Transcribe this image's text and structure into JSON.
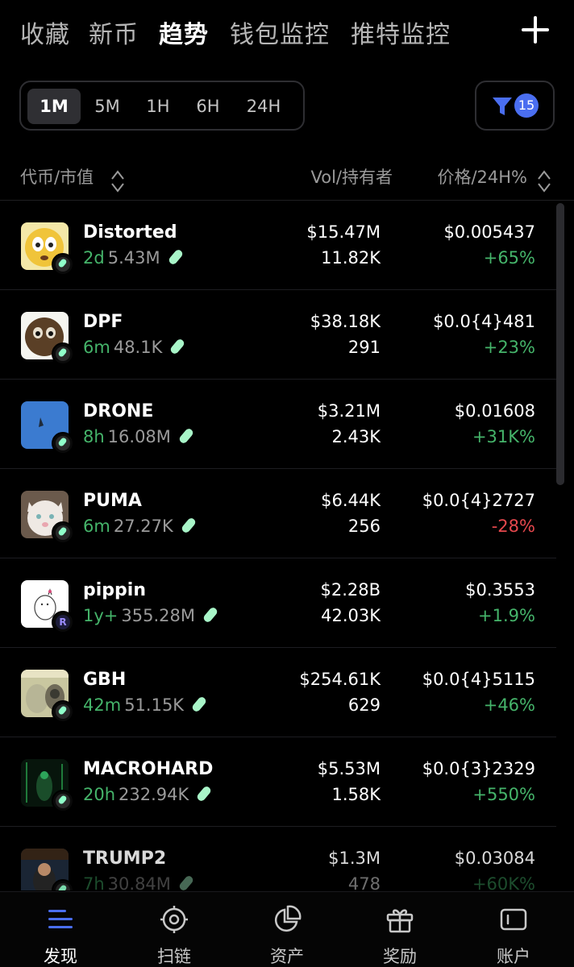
{
  "top_tabs": [
    {
      "label": "收藏"
    },
    {
      "label": "新币"
    },
    {
      "label": "趋势",
      "active": true
    },
    {
      "label": "钱包监控"
    },
    {
      "label": "推特监控"
    }
  ],
  "time_filters": [
    {
      "label": "1M",
      "active": true
    },
    {
      "label": "5M"
    },
    {
      "label": "1H"
    },
    {
      "label": "6H"
    },
    {
      "label": "24H"
    }
  ],
  "filter_count": "15",
  "columns": {
    "token": "代币/市值",
    "vol": "Vol/持有者",
    "price": "价格/24H%"
  },
  "rows": [
    {
      "name": "Distorted",
      "age": "2d",
      "mcap": "5.43M",
      "vol": "$15.47M",
      "holders": "11.82K",
      "price": "$0.005437",
      "change": "+65%",
      "trend": "up",
      "chip": "swap"
    },
    {
      "name": "DPF",
      "age": "6m",
      "mcap": "48.1K",
      "vol": "$38.18K",
      "holders": "291",
      "price": "$0.0{4}481",
      "change": "+23%",
      "trend": "up",
      "chip": "swap"
    },
    {
      "name": "DRONE",
      "age": "8h",
      "mcap": "16.08M",
      "vol": "$3.21M",
      "holders": "2.43K",
      "price": "$0.01608",
      "change": "+31K%",
      "trend": "up",
      "chip": "swap"
    },
    {
      "name": "PUMA",
      "age": "6m",
      "mcap": "27.27K",
      "vol": "$6.44K",
      "holders": "256",
      "price": "$0.0{4}2727",
      "change": "-28%",
      "trend": "down",
      "chip": "swap"
    },
    {
      "name": "pippin",
      "age": "1y+",
      "mcap": "355.28M",
      "vol": "$2.28B",
      "holders": "42.03K",
      "price": "$0.3553",
      "change": "+1.9%",
      "trend": "up",
      "chip": "raydium"
    },
    {
      "name": "GBH",
      "age": "42m",
      "mcap": "51.15K",
      "vol": "$254.61K",
      "holders": "629",
      "price": "$0.0{4}5115",
      "change": "+46%",
      "trend": "up",
      "chip": "swap"
    },
    {
      "name": "MACROHARD",
      "age": "20h",
      "mcap": "232.94K",
      "vol": "$5.53M",
      "holders": "1.58K",
      "price": "$0.0{3}2329",
      "change": "+550%",
      "trend": "up",
      "chip": "swap"
    },
    {
      "name": "TRUMP2",
      "age": "7h",
      "mcap": "30.84M",
      "vol": "$1.3M",
      "holders": "478",
      "price": "$0.03084",
      "change": "+60K%",
      "trend": "up",
      "chip": "swap"
    }
  ],
  "bottom_nav": [
    {
      "label": "发现",
      "icon": "discover-icon",
      "active": true
    },
    {
      "label": "扫链",
      "icon": "scan-icon"
    },
    {
      "label": "资产",
      "icon": "pie-chart-icon"
    },
    {
      "label": "奖励",
      "icon": "gift-icon"
    },
    {
      "label": "账户",
      "icon": "wallet-icon"
    }
  ],
  "colors": {
    "up": "#45b46a",
    "down": "#e5484d",
    "accent": "#4a6ef0",
    "background": "#000000"
  }
}
